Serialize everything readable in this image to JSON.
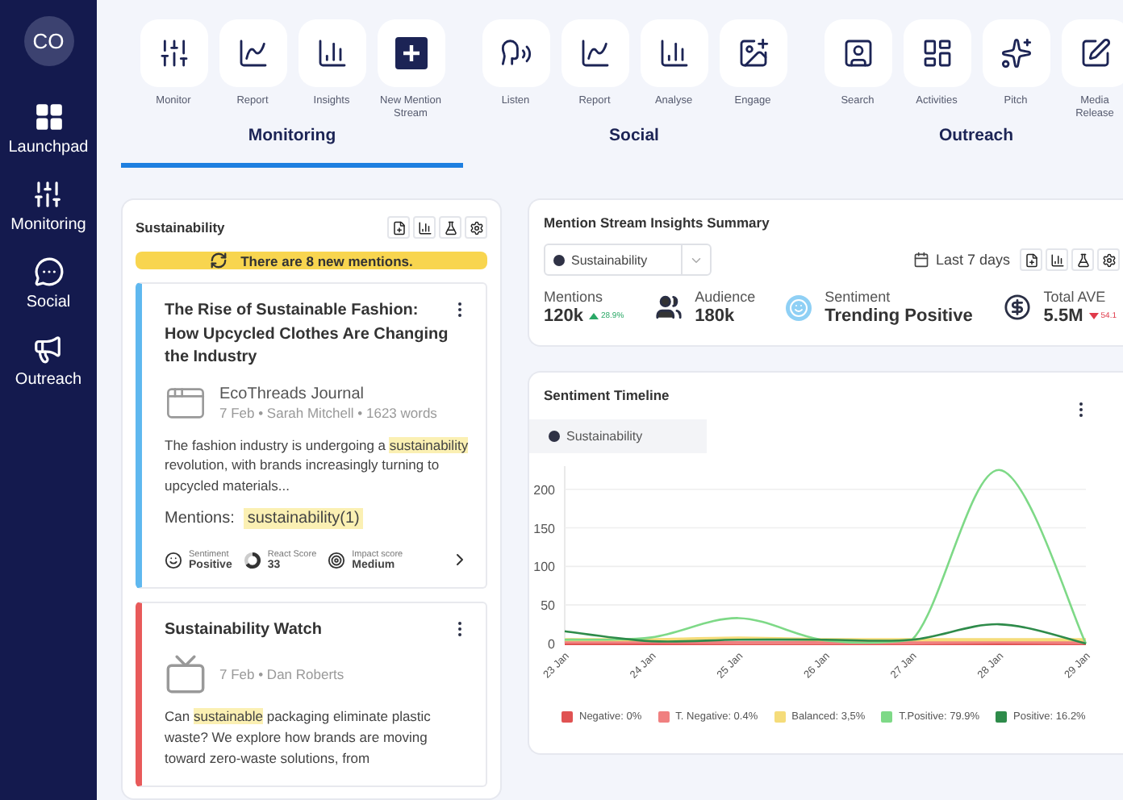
{
  "sidebar": {
    "avatar": "CO",
    "items": [
      {
        "kind": "launchpad",
        "label": "Launchpad"
      },
      {
        "kind": "monitoring",
        "label": "Monitoring"
      },
      {
        "kind": "social",
        "label": "Social"
      },
      {
        "kind": "outreach",
        "label": "Outreach"
      }
    ]
  },
  "tool_groups": [
    {
      "label": "Monitoring",
      "selected": true,
      "tools": [
        {
          "kind": "monitor",
          "label": "Monitor"
        },
        {
          "kind": "report",
          "label": "Report"
        },
        {
          "kind": "insights",
          "label": "Insights"
        },
        {
          "kind": "new",
          "label": "New Mention Stream"
        }
      ]
    },
    {
      "label": "Social",
      "selected": false,
      "tools": [
        {
          "kind": "listen",
          "label": "Listen"
        },
        {
          "kind": "report",
          "label": "Report"
        },
        {
          "kind": "insights",
          "label": "Analyse"
        },
        {
          "kind": "engage",
          "label": "Engage"
        }
      ]
    },
    {
      "label": "Outreach",
      "selected": false,
      "tools": [
        {
          "kind": "search",
          "label": "Search"
        },
        {
          "kind": "activities",
          "label": "Activities"
        },
        {
          "kind": "pitch",
          "label": "Pitch"
        },
        {
          "kind": "release",
          "label": "Media Release"
        }
      ]
    }
  ],
  "stream": {
    "title": "Sustainability",
    "banner": "There are 8 new mentions.",
    "mentions": [
      {
        "title": "The Rise of Sustainable Fashion: How Upcycled Clothes Are Changing the Industry",
        "color": "#5fb8ef",
        "kind": "web",
        "source": "EcoThreads Journal",
        "meta": "7 Feb • Sarah Mitchell • 1623 words",
        "body": [
          {
            "text": "The fashion industry is undergoing a ",
            "highlight": false
          },
          {
            "text": "sustainability",
            "highlight": true
          },
          {
            "text": " revolution, with brands increasingly turning to upcycled materials...",
            "highlight": false
          }
        ],
        "mentions_label": "Mentions:",
        "mentions_tag": "sustainability(1)",
        "scores": [
          {
            "kind": "sentiment",
            "label": "Sentiment",
            "value": "Positive"
          },
          {
            "kind": "react",
            "label": "React Score",
            "value": "33"
          },
          {
            "kind": "impact",
            "label": "Impact score",
            "value": "Medium"
          }
        ]
      },
      {
        "title": "Sustainability Watch",
        "color": "#e85a5a",
        "kind": "tv",
        "meta": "7 Feb • Dan Roberts",
        "body": [
          {
            "text": "Can ",
            "highlight": false
          },
          {
            "text": "sustainable",
            "highlight": true
          },
          {
            "text": " packaging eliminate plastic waste? We explore how brands are moving toward zero-waste solutions, from",
            "highlight": false
          }
        ]
      }
    ]
  },
  "summary": {
    "title": "Mention Stream Insights Summary",
    "stream_select": "Sustainability",
    "date_range": "Last 7 days",
    "stats": [
      {
        "kind": "mentions",
        "label": "Mentions",
        "value": "120k",
        "change": "28.9%",
        "rising": true
      },
      {
        "kind": "audience",
        "label": "Audience",
        "value": "180k"
      },
      {
        "kind": "sentiment",
        "label": "Sentiment",
        "value": "Trending Positive"
      },
      {
        "kind": "ave",
        "label": "Total AVE",
        "value": "5.5M",
        "change": "54.1",
        "rising": false
      }
    ]
  },
  "timeline": {
    "title": "Sentiment Timeline",
    "filter": "Sustainability",
    "chart_data": {
      "type": "line",
      "categories": [
        "23 Jan",
        "24 Jan",
        "25 Jan",
        "26 Jan",
        "27 Jan",
        "28 Jan",
        "29 Jan"
      ],
      "grid": true,
      "ylim": [
        0,
        230
      ],
      "yticks": [
        0,
        50,
        100,
        150,
        200
      ],
      "series": [
        {
          "name": "Negative: 0%",
          "color": "#e05252",
          "values": [
            0,
            0,
            0,
            0,
            0,
            0,
            0
          ]
        },
        {
          "name": "T. Negative: 0.4%",
          "color": "#f08080",
          "values": [
            2,
            2,
            1,
            1,
            1,
            2,
            1
          ]
        },
        {
          "name": "Balanced: 3,5%",
          "color": "#f5dc7a",
          "values": [
            5,
            5,
            7,
            5,
            5,
            5,
            5
          ]
        },
        {
          "name": "T.Positive: 79.9%",
          "color": "#7ed987",
          "values": [
            5,
            8,
            33,
            4,
            5,
            225,
            0
          ]
        },
        {
          "name": "Positive: 16.2%",
          "color": "#2e8b4a",
          "values": [
            16,
            3,
            5,
            5,
            5,
            25,
            0
          ]
        }
      ]
    }
  }
}
